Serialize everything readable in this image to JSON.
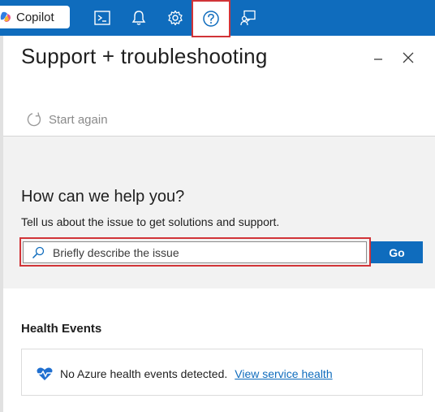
{
  "topbar": {
    "copilot_label": "Copilot",
    "icons": [
      "terminal-icon",
      "bell-icon",
      "gear-icon",
      "help-icon",
      "feedback-icon"
    ],
    "colors": {
      "bar": "#0f6cbd",
      "highlight": "#d13438"
    }
  },
  "panel": {
    "title": "Support + troubleshooting",
    "start_again": "Start again"
  },
  "help": {
    "title": "How can we help you?",
    "subtitle": "Tell us about the issue to get solutions and support.",
    "search_placeholder": "Briefly describe the issue",
    "search_value": "",
    "go_label": "Go"
  },
  "health": {
    "title": "Health Events",
    "message": "No Azure health events detected.",
    "link": "View service health"
  }
}
